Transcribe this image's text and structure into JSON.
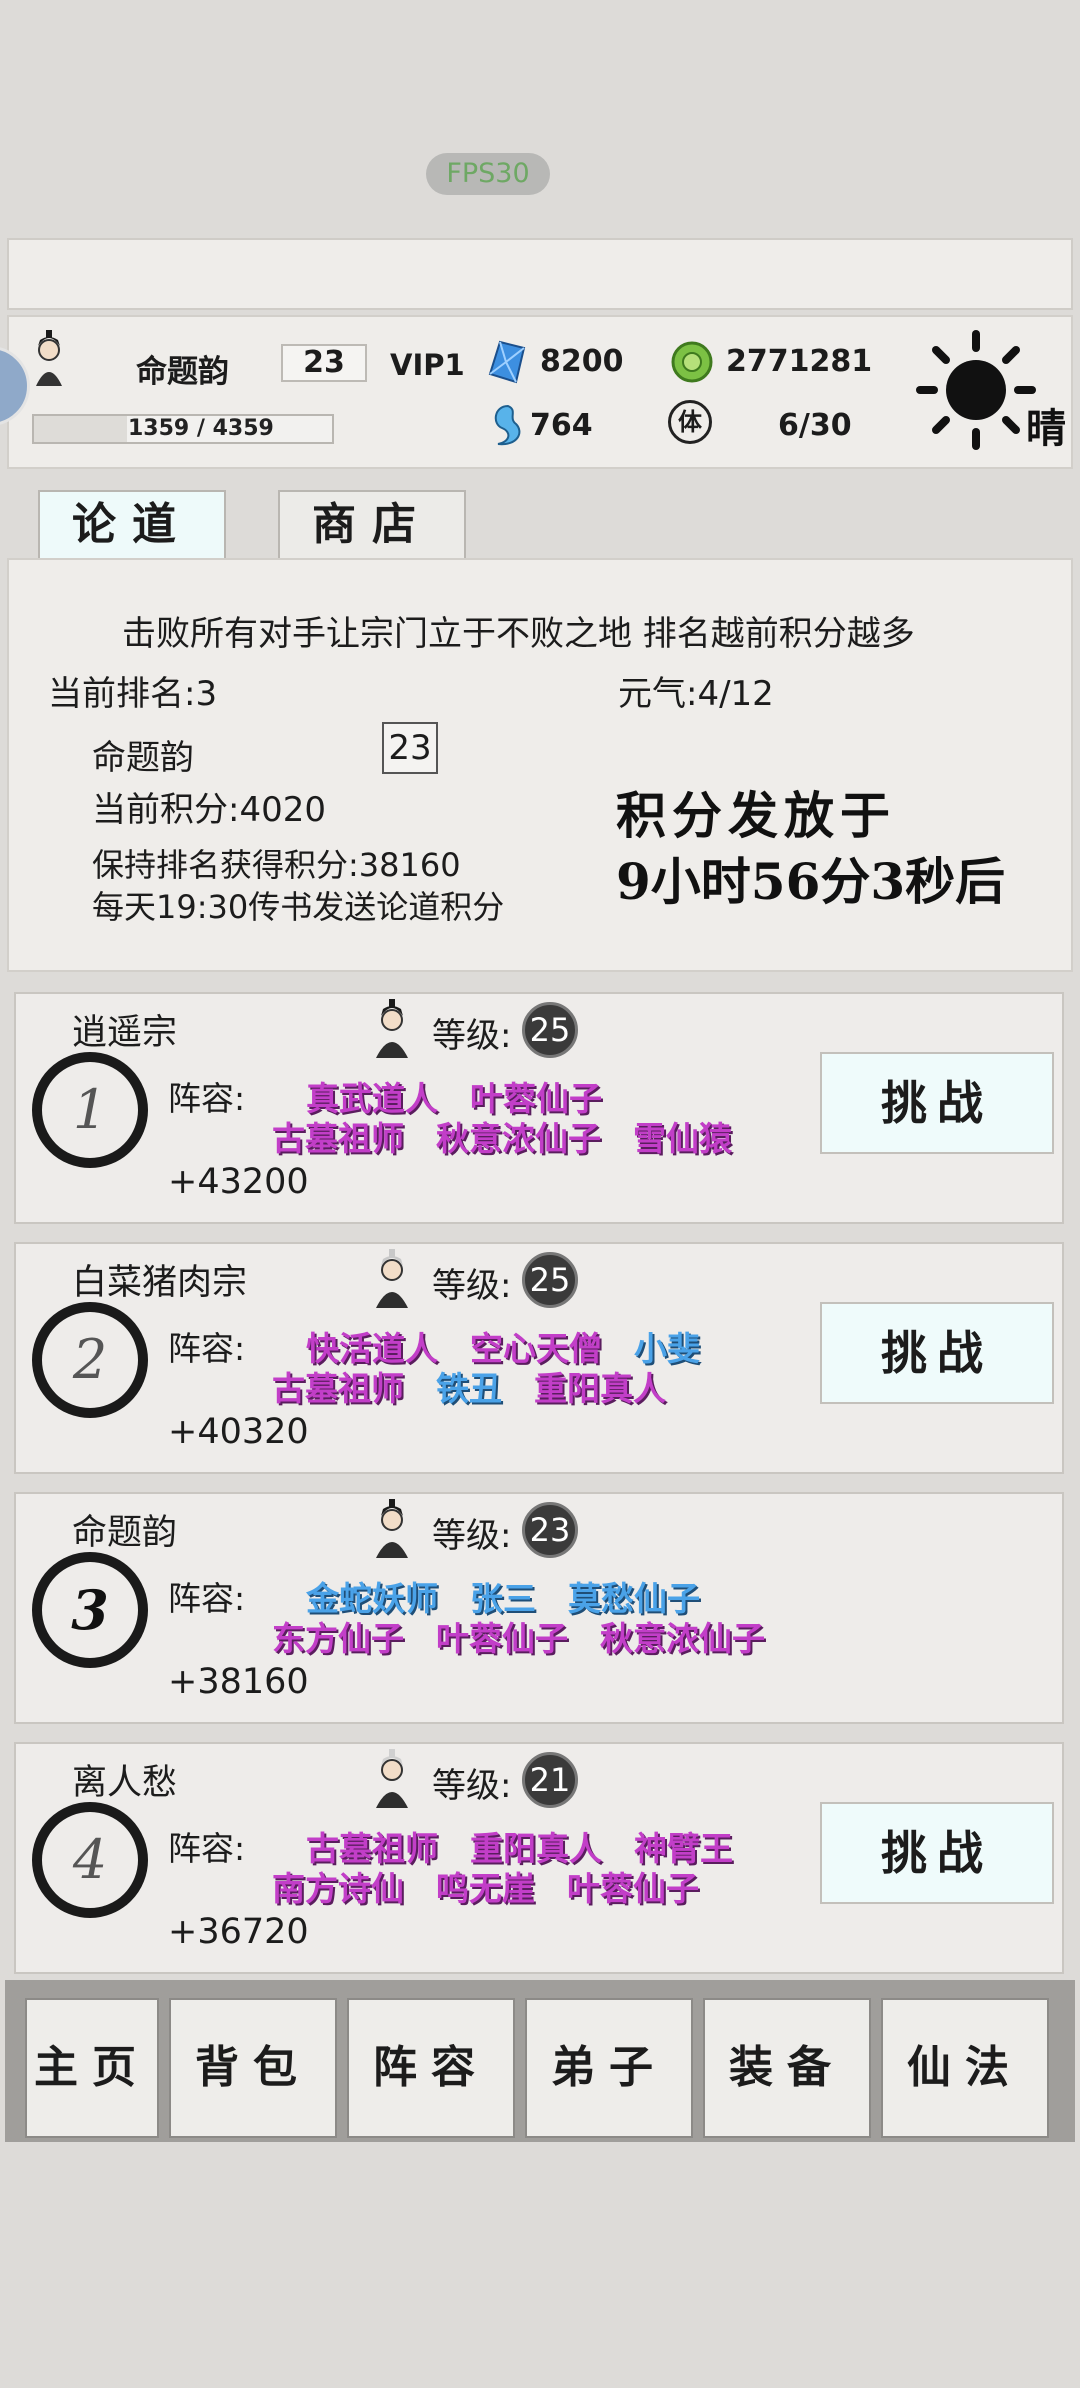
{
  "fps": "FPS30",
  "player": {
    "name": "命题韵",
    "level": "23",
    "vip": "VIP1",
    "exp": "1359 / 4359",
    "exp_fraction": 0.312,
    "gems": "8200",
    "coins": "2771281",
    "spirit": "764",
    "stamina_icon": "体",
    "stamina": "6/30",
    "weather": "晴"
  },
  "tabs": {
    "lundao": "论道",
    "shop": "商店"
  },
  "info": {
    "slogan": "击败所有对手让宗门立于不败之地 排名越前积分越多",
    "current_rank": "当前排名:3",
    "yuanqi": "元气:4/12",
    "name": "命题韵",
    "level": "23",
    "current_points": "当前积分:4020",
    "keep_points": "保持排名获得积分:38160",
    "daily_note": "每天19:30传书发送论道积分",
    "release_line1": "积分发放于",
    "release_line2": "9小时56分3秒后"
  },
  "opponents": [
    {
      "rank": "1",
      "sect": "逍遥宗",
      "level_label": "等级:",
      "level": "25",
      "lineup_label": "阵容:",
      "row1": [
        "真武道人",
        "叶蓉仙子"
      ],
      "row2": [
        "古墓祖师",
        "秋意浓仙子",
        "雪仙猿"
      ],
      "score": "+43200",
      "challenge": "挑战"
    },
    {
      "rank": "2",
      "sect": "白菜猪肉宗",
      "level_label": "等级:",
      "level": "25",
      "lineup_label": "阵容:",
      "row1": [
        "快活道人",
        "空心天僧",
        "小斐"
      ],
      "row2": [
        "古墓祖师",
        "铁丑",
        "重阳真人"
      ],
      "score": "+40320",
      "challenge": "挑战"
    },
    {
      "rank": "3",
      "sect": "命题韵",
      "level_label": "等级:",
      "level": "23",
      "lineup_label": "阵容:",
      "row1": [
        "金蛇妖师",
        "张三",
        "莫愁仙子"
      ],
      "row2": [
        "东方仙子",
        "叶蓉仙子",
        "秋意浓仙子"
      ],
      "score": "+38160",
      "challenge": ""
    },
    {
      "rank": "4",
      "sect": "离人愁",
      "level_label": "等级:",
      "level": "21",
      "lineup_label": "阵容:",
      "row1": [
        "古墓祖师",
        "重阳真人",
        "神臂王"
      ],
      "row2": [
        "南方诗仙",
        "鸣无崖",
        "叶蓉仙子"
      ],
      "score": "+36720",
      "challenge": "挑战"
    }
  ],
  "nav": [
    "主页",
    "背包",
    "阵容",
    "弟子",
    "装备",
    "仙法"
  ],
  "colors": {
    "purple": "#c23ec8",
    "blue": "#4aa2e8",
    "tab_active": "#eefafa"
  }
}
